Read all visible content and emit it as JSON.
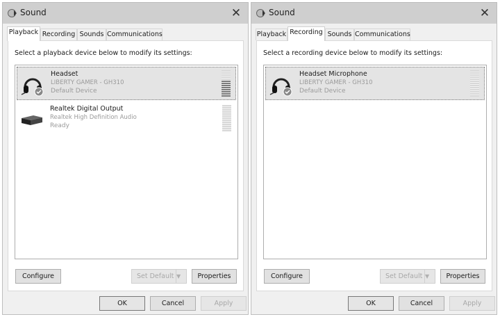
{
  "windows": [
    {
      "title": "Sound",
      "tabs": [
        "Playback",
        "Recording",
        "Sounds",
        "Communications"
      ],
      "active_tab": "Playback",
      "prompt": "Select a playback device below to modify its settings:",
      "devices": [
        {
          "name": "Headset",
          "sub": "LIBERTY GAMER - GH310",
          "status": "Default Device",
          "icon": "headset-icon",
          "selected": true,
          "level": 0.6
        },
        {
          "name": "Realtek Digital Output",
          "sub": "Realtek High Definition Audio",
          "status": "Ready",
          "icon": "speaker-box-icon",
          "selected": false,
          "level": 0
        }
      ],
      "buttons": {
        "configure": "Configure",
        "set_default": "Set Default",
        "properties": "Properties",
        "ok": "OK",
        "cancel": "Cancel",
        "apply": "Apply"
      }
    },
    {
      "title": "Sound",
      "tabs": [
        "Playback",
        "Recording",
        "Sounds",
        "Communications"
      ],
      "active_tab": "Recording",
      "prompt": "Select a recording device below to modify its settings:",
      "devices": [
        {
          "name": "Headset Microphone",
          "sub": "LIBERTY GAMER - GH310",
          "status": "Default Device",
          "icon": "headset-icon",
          "selected": true,
          "level": 0
        }
      ],
      "buttons": {
        "configure": "Configure",
        "set_default": "Set Default",
        "properties": "Properties",
        "ok": "OK",
        "cancel": "Cancel",
        "apply": "Apply"
      }
    }
  ]
}
